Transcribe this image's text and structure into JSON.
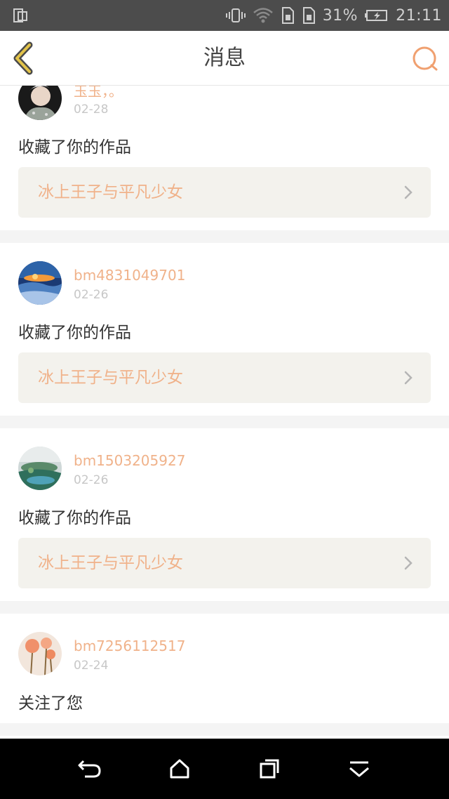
{
  "status_bar": {
    "battery_percent": "31%",
    "time": "21:11"
  },
  "header": {
    "title": "消息"
  },
  "messages": [
    {
      "username": "玉玉，。",
      "date": "02-28",
      "action": "收藏了你的作品",
      "work_title": "冰上王子与平凡少女"
    },
    {
      "username": "bm4831049701",
      "date": "02-26",
      "action": "收藏了你的作品",
      "work_title": "冰上王子与平凡少女"
    },
    {
      "username": "bm1503205927",
      "date": "02-26",
      "action": "收藏了你的作品",
      "work_title": "冰上王子与平凡少女"
    },
    {
      "username": "bm7256112517",
      "date": "02-24",
      "action": "关注了您"
    }
  ],
  "colors": {
    "accent": "#f0b28a",
    "back_arrow": "#d9b43a",
    "link_bg": "#f3f2ed"
  }
}
